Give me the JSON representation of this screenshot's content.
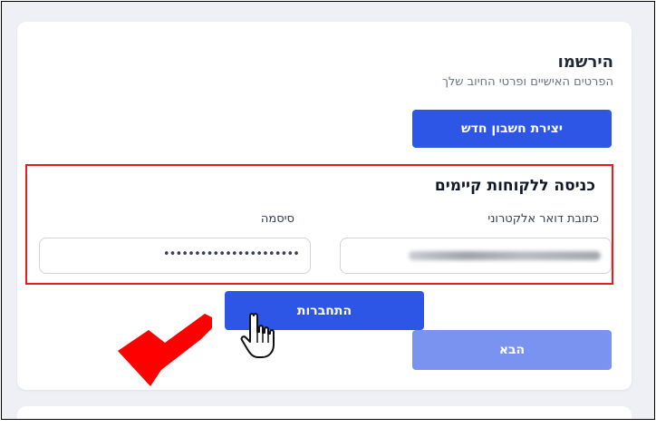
{
  "register": {
    "title": "הירשמו",
    "subtitle": "הפרטים האישיים ופרטי החיוב שלך",
    "create_account_button": "יצירת חשבון חדש"
  },
  "login": {
    "title": "כניסה ללקוחות קיימים",
    "email_label": "כתובת דואר אלקטרוני",
    "password_label": "סיסמה",
    "password_value": "••••••••••••••••••••••",
    "login_button": "התחברות"
  },
  "next_button": "הבא",
  "colors": {
    "primary": "#2d55e6",
    "disabled": "#7b93f0",
    "highlight": "#e01e1e",
    "arrow": "#ff0000"
  }
}
